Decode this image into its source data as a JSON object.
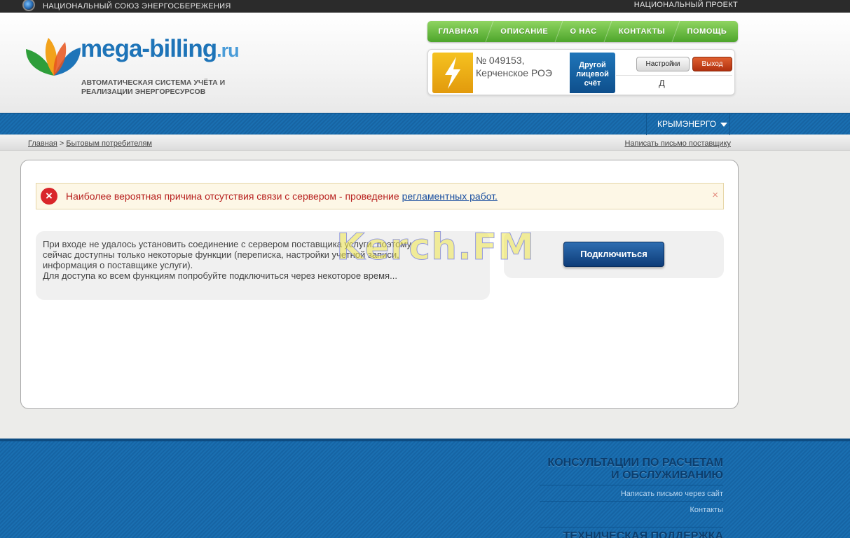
{
  "topbar": {
    "left_text": "НАЦИОНАЛЬНЫЙ СОЮЗ ЭНЕРГОСБЕРЕЖЕНИЯ",
    "right_text": "НАЦИОНАЛЬНЫЙ ПРОЕКТ"
  },
  "logo": {
    "brand": "mega-billing",
    "tld": ".ru",
    "slogan_line1": "АВТОМАТИЧЕСКАЯ СИСТЕМА УЧЁТА И",
    "slogan_line2": "РЕАЛИЗАЦИИ ЭНЕРГОРЕСУРСОВ"
  },
  "nav": {
    "items": [
      "ГЛАВНАЯ",
      "ОПИСАНИЕ",
      "О НАС",
      "КОНТАКТЫ",
      "ПОМОЩЬ"
    ]
  },
  "account": {
    "number": "№ 049153,",
    "company": "Керченское РОЭ",
    "other_line1": "Другой",
    "other_line2": "лицевой",
    "other_line3": "счёт",
    "settings_label": "Настройки",
    "logout_label": "Выход",
    "user_initial": "Д"
  },
  "region": {
    "label": "КРЫМЭНЕРГО"
  },
  "breadcrumb": {
    "home": "Главная",
    "separator": " > ",
    "current": "Бытовым потребителям",
    "write_supplier": "Написать письмо поставщику"
  },
  "alert": {
    "text": "Наиболее вероятная причина отсутствия связи с сервером - проведение ",
    "link": "регламентных работ.",
    "close": "×",
    "icon": "error-icon"
  },
  "info": {
    "line1": "При входе не удалось установить соединение с сервером поставщика услуги, поэтому",
    "line2": "сейчас доступны только некоторые функции (переписка, настройки учетной записи,",
    "line3": "информация о поставщике услуги).",
    "line4": "Для доступа ко всем функциям попробуйте подключиться через некоторое время..."
  },
  "connect": {
    "label": "Подключиться"
  },
  "watermark": {
    "text": "Kerch.FM"
  },
  "footer": {
    "consult_line1": "КОНСУЛЬТАЦИИ ПО РАСЧЕТАМ",
    "consult_line2": "И ОБСЛУЖИВАНИЮ",
    "link_write": "Написать письмо через сайт",
    "link_contacts": "Контакты",
    "support_title": "ТЕХНИЧЕСКАЯ ПОДДЕРЖКА"
  },
  "colors": {
    "accent_green": "#4da52b",
    "accent_blue": "#1a6fb1",
    "error_red": "#d9262b",
    "logout_red": "#b0300f"
  }
}
